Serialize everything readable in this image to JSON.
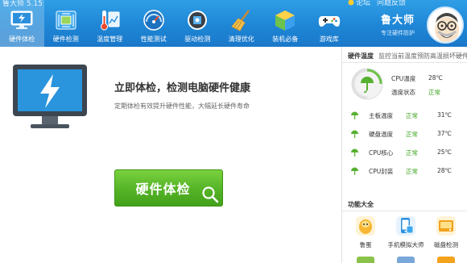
{
  "window": {
    "title": "鲁大师 5.15"
  },
  "top_links": [
    "论坛",
    "问题反馈"
  ],
  "nav": [
    {
      "label": "硬件体检",
      "icon": "monitor-bolt-icon",
      "active": true
    },
    {
      "label": "硬件检测",
      "icon": "circuit-board-icon",
      "active": false
    },
    {
      "label": "温度管理",
      "icon": "thermometer-icon",
      "active": false
    },
    {
      "label": "性能测试",
      "icon": "speedometer-icon",
      "active": false
    },
    {
      "label": "驱动检测",
      "icon": "gear-chip-icon",
      "active": false
    },
    {
      "label": "清理优化",
      "icon": "broom-icon",
      "active": false
    },
    {
      "label": "装机必备",
      "icon": "cube-icon",
      "active": false
    },
    {
      "label": "游戏库",
      "icon": "gamepad-icon",
      "active": false
    }
  ],
  "brand": {
    "name": "鲁大师",
    "slogan": "专注硬件防护"
  },
  "main": {
    "title": "立即体检，检测电脑硬件健康",
    "subtitle": "定期体检有效提升硬件性能，大幅延长硬件寿命",
    "scan_button": "硬件体检"
  },
  "side": {
    "header_title": "硬件温度",
    "header_sub": "监控当前温度预防高温损坏硬件",
    "cpu_temp_label": "CPU温度",
    "cpu_temp_value": "28℃",
    "temp_state_label": "温度状态",
    "temp_state_value": "正常",
    "rows": [
      {
        "name": "主板温度",
        "status": "正常",
        "value": "31℃"
      },
      {
        "name": "硬盘温度",
        "status": "正常",
        "value": "37℃"
      },
      {
        "name": "CPU核心",
        "status": "正常",
        "value": "25℃"
      },
      {
        "name": "CPU封装",
        "status": "正常",
        "value": "28℃"
      }
    ],
    "functions_title": "功能大全",
    "functions": [
      {
        "label": "鲁蛋",
        "icon": "egg-mascot-icon"
      },
      {
        "label": "手机模拟大师",
        "icon": "phone-emulator-icon"
      },
      {
        "label": "磁盘检测",
        "icon": "disk-check-icon"
      }
    ]
  },
  "colors": {
    "accent": "#1f86d6",
    "ok": "#3aa31c",
    "button": "#57b528"
  }
}
